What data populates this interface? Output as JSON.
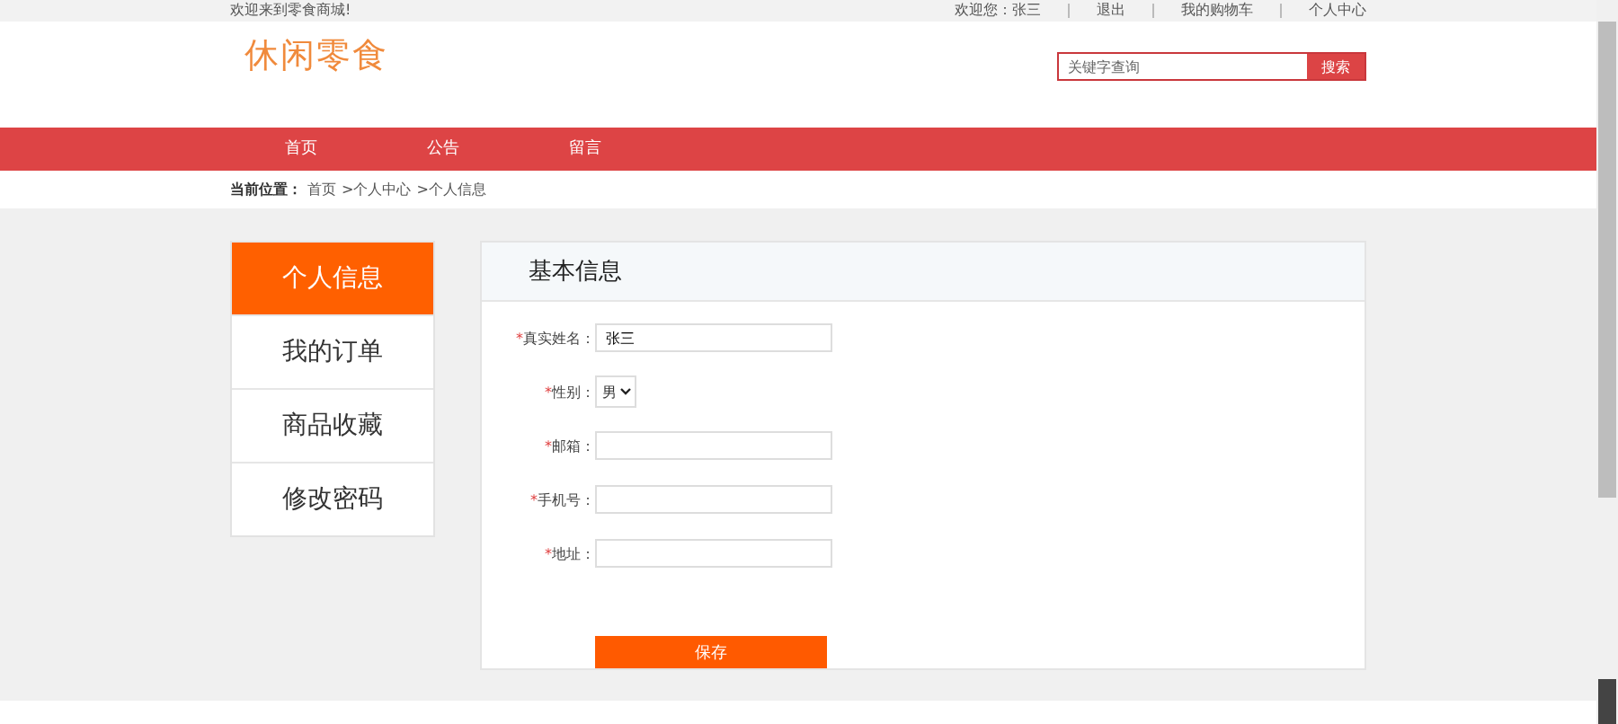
{
  "top_bar": {
    "welcome": "欢迎来到零食商城!",
    "links": [
      "欢迎您：张三",
      "退出",
      "我的购物车",
      "个人中心"
    ]
  },
  "header": {
    "logo": "休闲零食",
    "search": {
      "placeholder": "关键字查询",
      "button": "搜索"
    }
  },
  "nav": [
    "首页",
    "公告",
    "留言"
  ],
  "breadcrumb": {
    "label": "当前位置：",
    "crumbs": [
      "首页",
      ">个人中心",
      ">个人信息"
    ]
  },
  "sidebar": [
    {
      "label": "个人信息",
      "selected": true
    },
    {
      "label": "我的订单",
      "selected": false
    },
    {
      "label": "商品收藏",
      "selected": false
    },
    {
      "label": "修改密码",
      "selected": false
    }
  ],
  "panel": {
    "title": "基本信息",
    "fields": [
      {
        "kind": "text",
        "mark": "*",
        "label": "真实姓名：",
        "value": "张三"
      },
      {
        "kind": "select",
        "mark": "*",
        "label": "性别：",
        "value": "男"
      },
      {
        "kind": "text",
        "mark": "*",
        "label": "邮箱："
      },
      {
        "kind": "text",
        "mark": "*",
        "label": "手机号："
      },
      {
        "kind": "text",
        "mark": "*",
        "label": "地址："
      }
    ],
    "button": "保存"
  }
}
